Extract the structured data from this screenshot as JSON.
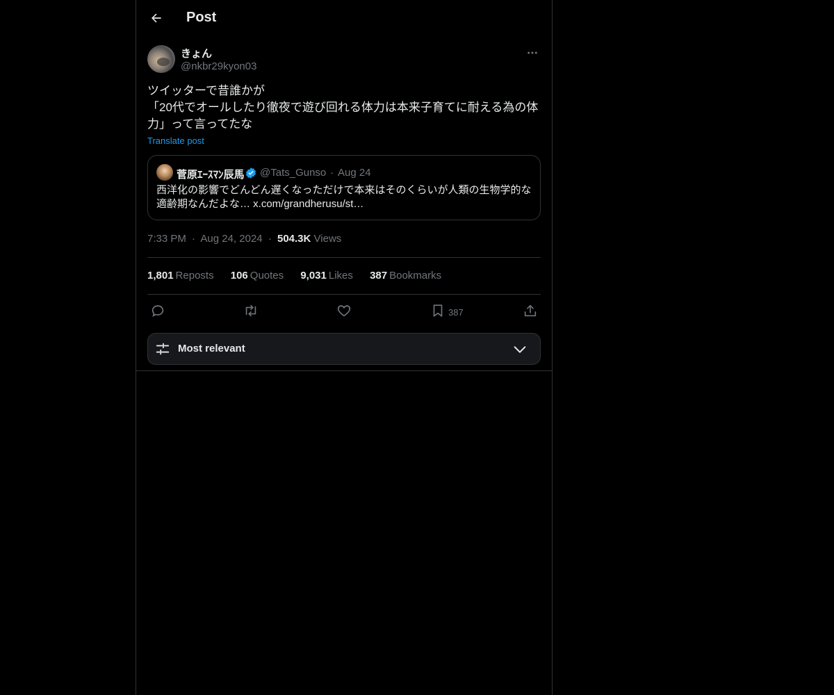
{
  "header": {
    "title": "Post",
    "back_icon": "arrow-left-icon"
  },
  "post": {
    "author": {
      "display_name": "きょん",
      "handle": "@nkbr29kyon03"
    },
    "text": "ツイッターで昔誰かが\n「20代でオールしたり徹夜で遊び回れる体力は本来子育てに耐える為の体力」って言ってたな",
    "translate_label": "Translate post",
    "quote": {
      "display_name": "菅原ｴｰｽﾏﾝ辰馬",
      "verified": true,
      "handle": "@Tats_Gunso",
      "separator": "·",
      "date": "Aug 24",
      "text": "西洋化の影響でどんどん遅くなっただけで本来はそのくらいが人類の生物学的な適齢期なんだよな… x.com/grandherusu/st…"
    },
    "meta": {
      "time": "7:33 PM",
      "sep1": "·",
      "date": "Aug 24, 2024",
      "sep2": "·",
      "views_count": "504.3K",
      "views_label": "Views"
    },
    "stats": {
      "reposts_count": "1,801",
      "reposts_label": "Reposts",
      "quotes_count": "106",
      "quotes_label": "Quotes",
      "likes_count": "9,031",
      "likes_label": "Likes",
      "bookmarks_count": "387",
      "bookmarks_label": "Bookmarks"
    },
    "actions": {
      "reply_icon": "reply-icon",
      "repost_icon": "repost-icon",
      "like_icon": "heart-icon",
      "bookmark_icon": "bookmark-icon",
      "bookmark_count": "387",
      "share_icon": "share-icon"
    }
  },
  "replies_sort": {
    "label": "Most relevant",
    "icon": "sliders-icon",
    "chevron_icon": "chevron-down-icon"
  },
  "colors": {
    "background": "#000000",
    "text_primary": "#e7e9ea",
    "text_secondary": "#71767b",
    "accent": "#1d9bf0",
    "border": "#2f3336"
  }
}
